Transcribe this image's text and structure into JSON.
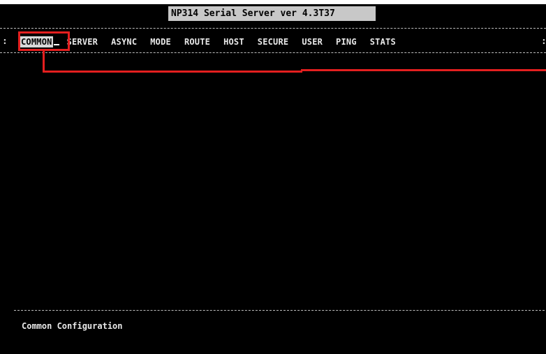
{
  "title": "NP314 Serial Server ver 4.3T37",
  "menu": {
    "items": [
      {
        "label": "COMMON",
        "active": true
      },
      {
        "label": "SERVER",
        "active": false
      },
      {
        "label": "ASYNC",
        "active": false
      },
      {
        "label": "MODE",
        "active": false
      },
      {
        "label": "ROUTE",
        "active": false
      },
      {
        "label": "HOST",
        "active": false
      },
      {
        "label": "SECURE",
        "active": false
      },
      {
        "label": "USER",
        "active": false
      },
      {
        "label": "PING",
        "active": false
      },
      {
        "label": "STATS",
        "active": false
      }
    ],
    "edge_left": ":",
    "edge_right": ":"
  },
  "status": {
    "text": "Common Configuration"
  },
  "colors": {
    "screen_bg": "#000000",
    "text": "#e8e8e8",
    "title_bg": "#c8c8c8",
    "highlight": "#e41f1f"
  }
}
